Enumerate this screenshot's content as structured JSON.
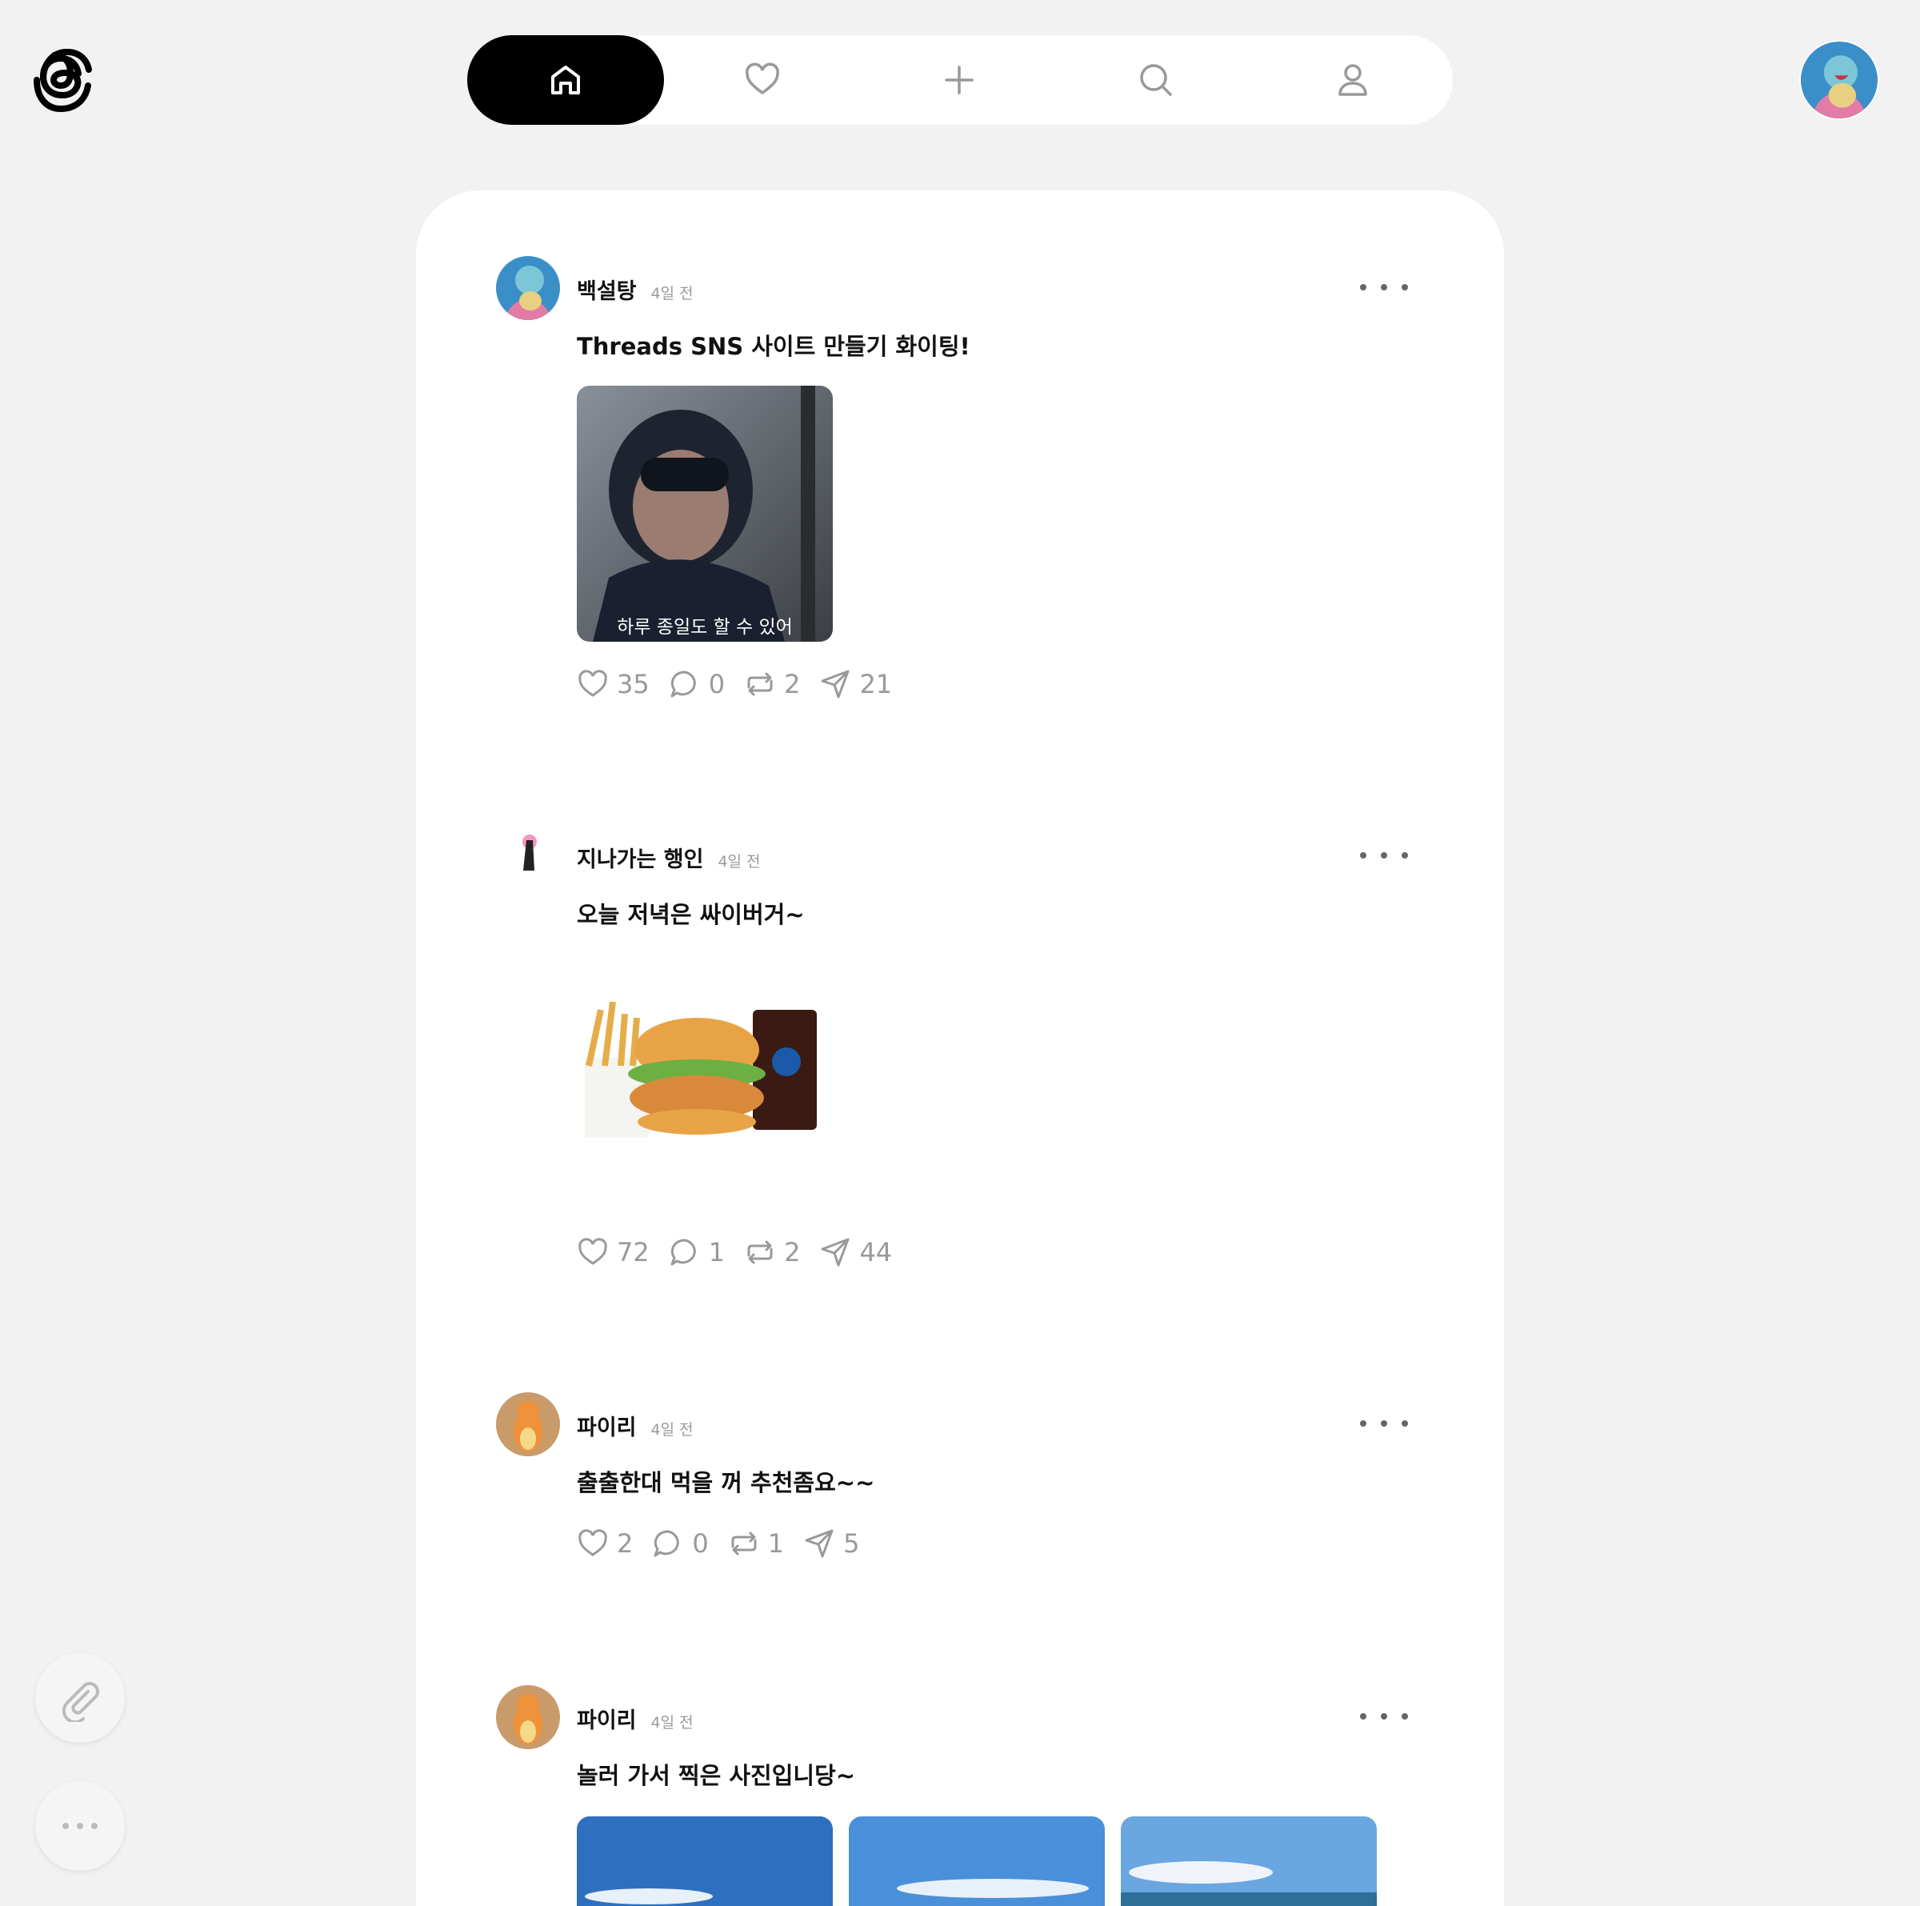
{
  "nav": {
    "items": [
      {
        "icon": "home-icon",
        "active": true
      },
      {
        "icon": "heart-icon",
        "active": false
      },
      {
        "icon": "plus-icon",
        "active": false
      },
      {
        "icon": "search-icon",
        "active": false
      },
      {
        "icon": "profile-icon",
        "active": false
      }
    ]
  },
  "posts": [
    {
      "author": "백설탕",
      "time": "4일 전",
      "text": "Threads SNS 사이트 만들기 화이팅!",
      "image_caption": "하루 종일도 할 수 있어",
      "likes": "35",
      "comments": "0",
      "reposts": "2",
      "shares": "21"
    },
    {
      "author": "지나가는 행인",
      "time": "4일 전",
      "text": "오늘 저녁은 싸이버거~",
      "likes": "72",
      "comments": "1",
      "reposts": "2",
      "shares": "44"
    },
    {
      "author": "파이리",
      "time": "4일 전",
      "text": "출출한대 먹을 꺼 추천좀요~~",
      "likes": "2",
      "comments": "0",
      "reposts": "1",
      "shares": "5"
    },
    {
      "author": "파이리",
      "time": "4일 전",
      "text": "놀러 가서 찍은 사진입니당~"
    }
  ],
  "colors": {
    "accent": "#000000",
    "muted": "#999999",
    "background": "#f2f2f2"
  }
}
